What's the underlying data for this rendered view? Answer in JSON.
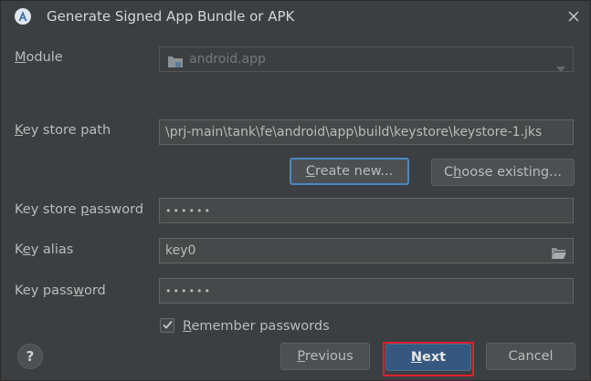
{
  "window": {
    "title": "Generate Signed App Bundle or APK",
    "icon": "android-studio-icon",
    "close_icon": "close-icon"
  },
  "form": {
    "module": {
      "label_pre": "",
      "label_ul": "M",
      "label_post": "odule",
      "value": "android.app"
    },
    "key_store_path": {
      "label_pre": "",
      "label_ul": "K",
      "label_post": "ey store path",
      "value": "\\prj-main\\tank\\fe\\android\\app\\build\\keystore\\keystore-1.jks"
    },
    "create_new": {
      "pre": "",
      "ul": "C",
      "post": "reate new..."
    },
    "choose_existing": {
      "pre": "C",
      "ul": "h",
      "post": "oose existing..."
    },
    "key_store_password": {
      "label_pre": "Key store ",
      "label_ul": "p",
      "label_post": "assword",
      "value": "••••••"
    },
    "key_alias": {
      "label_pre": "K",
      "label_ul": "e",
      "label_post": "y alias",
      "value": "key0"
    },
    "key_password": {
      "label_pre": "Key pass",
      "label_ul": "w",
      "label_post": "ord",
      "value": "••••••"
    },
    "remember": {
      "pre": "",
      "ul": "R",
      "post": "emember passwords",
      "checked": true
    }
  },
  "buttons": {
    "help": "?",
    "previous": {
      "pre": "",
      "ul": "P",
      "post": "revious"
    },
    "next": {
      "pre": "",
      "ul": "N",
      "post": "ext"
    },
    "cancel": "Cancel"
  },
  "colors": {
    "background": "#3c3f41",
    "default_button": "#365880",
    "focus_border": "#4a88c7",
    "highlight_box": "#e0202e"
  }
}
